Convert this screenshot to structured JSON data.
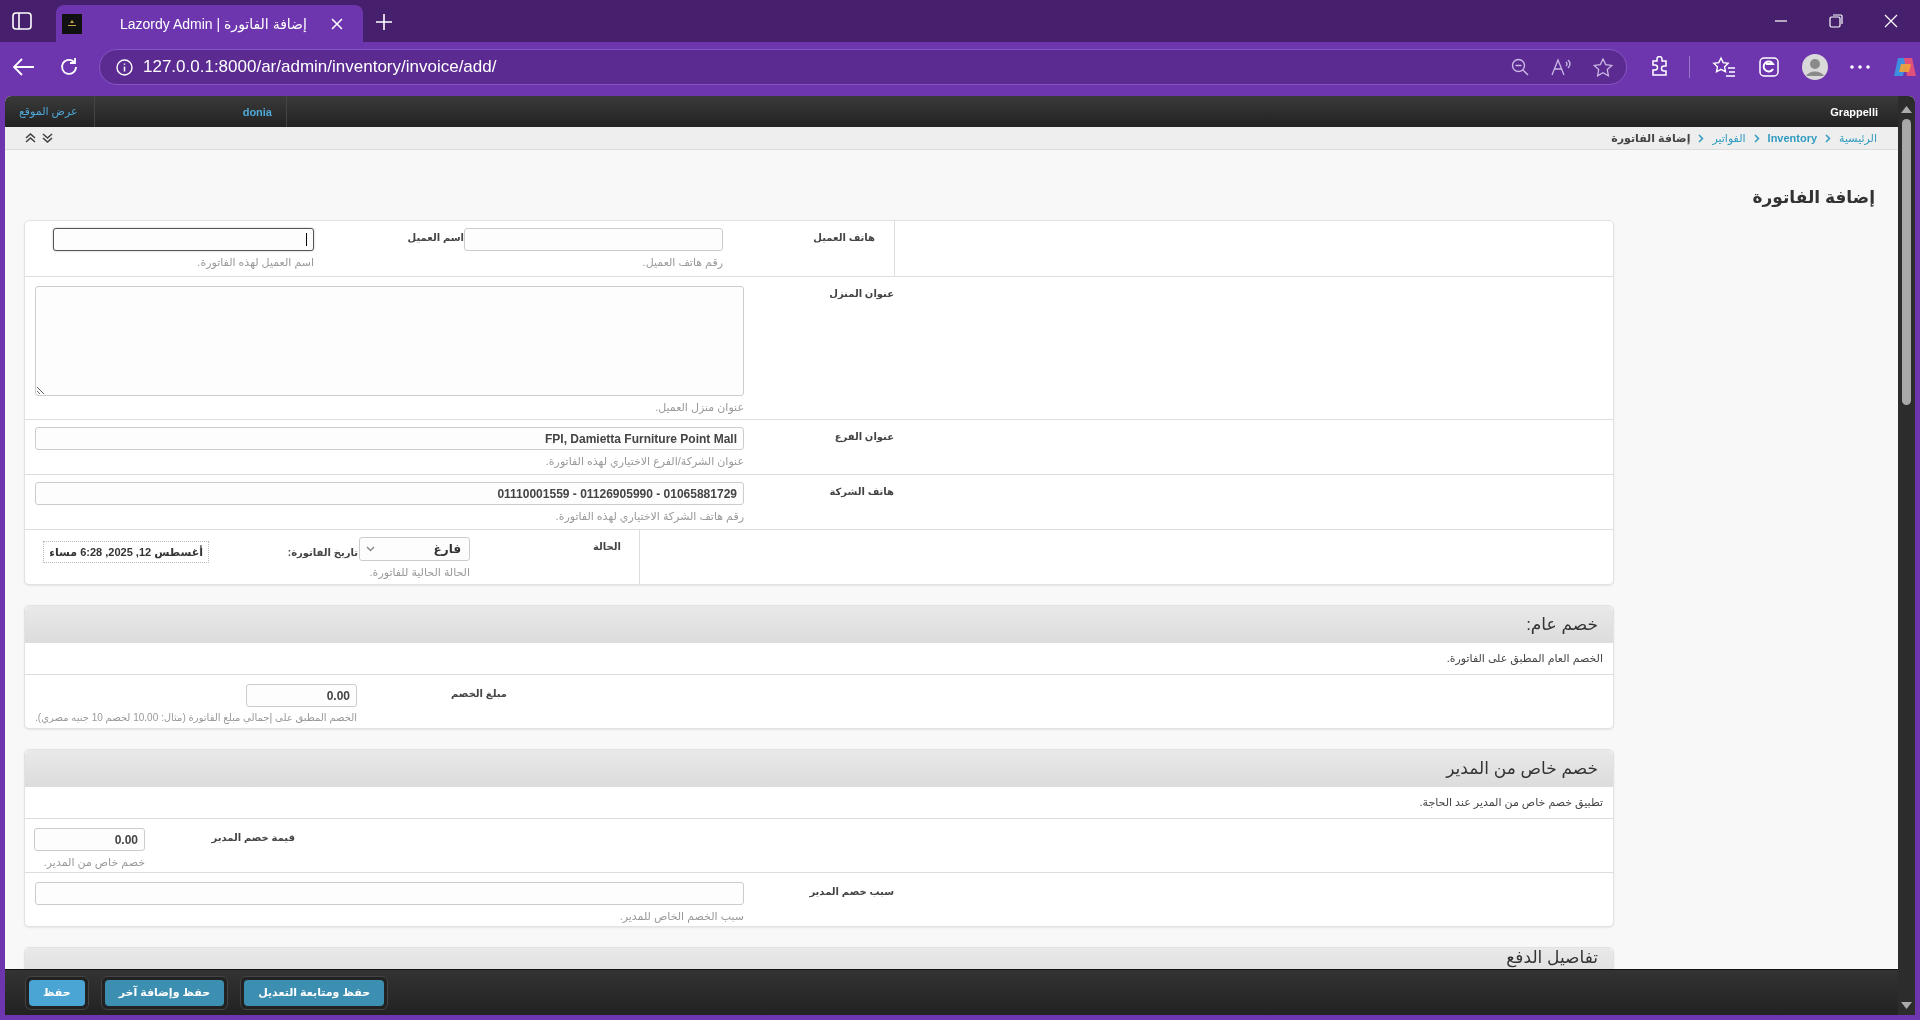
{
  "browser": {
    "tab_title": "Lazordy Admin | إضافة الفاتورة",
    "url": "127.0.0.1:8000/ar/admin/inventory/invoice/add/"
  },
  "header": {
    "brand": "Grappelli",
    "user": "donia",
    "site_link": "عرض الموقع"
  },
  "breadcrumbs": [
    {
      "label": "الرئيسية",
      "kind": "link"
    },
    {
      "label": "Inventory",
      "kind": "app"
    },
    {
      "label": "الفواتير",
      "kind": "link"
    },
    {
      "label": "إضافة الفاتورة",
      "kind": "current"
    }
  ],
  "page_title": "إضافة الفاتورة",
  "invoice_fieldset": {
    "rows": [
      {
        "kind": "multi",
        "fields": [
          {
            "label": "هاتف العميل",
            "kind": "input",
            "help": "رقم هاتف العميل.",
            "focused": false
          },
          {
            "label": "اسم العميل",
            "kind": "input",
            "help": "اسم العميل لهذه الفاتورة.",
            "focused": true
          }
        ]
      },
      {
        "kind": "single",
        "fields": [
          {
            "label": "عنوان المنزل",
            "kind": "textarea",
            "help": "عنوان منزل العميل.",
            "focused": false
          }
        ]
      },
      {
        "kind": "single",
        "fields": [
          {
            "label": "عنوان الفرع",
            "kind": "input",
            "value": "FPI, Damietta Furniture Point Mall",
            "help": "عنوان الشركة/الفرع الاختياري لهذه الفاتورة.",
            "focused": false
          }
        ]
      },
      {
        "kind": "single",
        "fields": [
          {
            "label": "هاتف الشركة",
            "kind": "input",
            "value": "01065881729 - 01126905990 - 01110001559",
            "help": "رقم هاتف الشركة الاختياري لهذه الفاتورة.",
            "focused": false
          }
        ]
      },
      {
        "kind": "multi",
        "fields": [
          {
            "label": "الحالة",
            "kind": "select",
            "value": "فارغ",
            "help": "الحالة الحالية للفاتورة.",
            "focused": false
          },
          {
            "label": "تاريخ الفاتورة:",
            "kind": "readonly",
            "value": "أغسطس 12, 2025, 6:28 مساء",
            "focused": false
          }
        ]
      }
    ]
  },
  "sections": [
    {
      "title": "خصم عام:",
      "description": "الخصم العام المطبق على الفاتورة.",
      "rows": [
        {
          "kind": "single",
          "fields": [
            {
              "label": "مبلغ الخصم",
              "kind": "input",
              "value": "0.00",
              "help": "الخصم المطبق على إجمالي مبلغ الفاتورة (مثال: 10.00 لخصم 10 جنيه مصري).",
              "focused": false
            }
          ]
        }
      ]
    },
    {
      "title": "خصم خاص من المدير",
      "description": "تطبيق خصم خاص من المدير عند الحاجة.",
      "rows": [
        {
          "kind": "single",
          "fields": [
            {
              "label": "قيمة خصم المدير",
              "kind": "input",
              "value": "0.00",
              "help": "خصم خاص من المدير.",
              "focused": false
            }
          ]
        },
        {
          "kind": "single",
          "fields": [
            {
              "label": "سبب خصم المدير",
              "kind": "input",
              "help": "سبب الخصم الخاص للمدير.",
              "focused": false
            }
          ]
        }
      ]
    },
    {
      "title": "تفاصيل الدفع"
    }
  ],
  "buttons": [
    {
      "label": "حفظ ومتابعة التعديل",
      "kind": "secondary"
    },
    {
      "label": "حفظ وإضافة آخر",
      "kind": "secondary"
    },
    {
      "label": "حفظ",
      "kind": "primary"
    }
  ]
}
